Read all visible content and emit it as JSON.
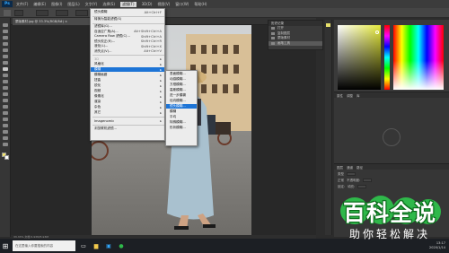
{
  "menubar": {
    "logo": "Ps",
    "items": [
      "文件(F)",
      "编辑(E)",
      "图像(I)",
      "图层(L)",
      "文字(Y)",
      "选择(S)",
      "滤镜(T)",
      "3D(D)",
      "视图(V)",
      "窗口(W)",
      "帮助(H)"
    ],
    "active_index": 6
  },
  "document_tab": "蒙版素材.jpg @ 33.3%(RGB/8#) ×",
  "filter_menu": {
    "items": [
      {
        "label": "镜头模糊",
        "shortcut": "Alt+Ctrl+F"
      },
      {
        "label": "转换为智能滤镜(S)",
        "shortcut": ""
      },
      {
        "label": "滤镜库(G)...",
        "shortcut": ""
      },
      {
        "label": "自适应广角(A)...",
        "shortcut": "Alt+Shift+Ctrl+A"
      },
      {
        "label": "Camera Raw 滤镜(C)...",
        "shortcut": "Shift+Ctrl+A"
      },
      {
        "label": "镜头校正(R)...",
        "shortcut": "Shift+Ctrl+R"
      },
      {
        "label": "液化(L)...",
        "shortcut": "Shift+Ctrl+X"
      },
      {
        "label": "消失点(V)...",
        "shortcut": "Alt+Ctrl+V"
      },
      {
        "label": "3D",
        "shortcut": "▸"
      },
      {
        "label": "风格化",
        "shortcut": "▸"
      },
      {
        "label": "模糊",
        "shortcut": "▸"
      },
      {
        "label": "模糊画廊",
        "shortcut": "▸"
      },
      {
        "label": "扭曲",
        "shortcut": "▸"
      },
      {
        "label": "锐化",
        "shortcut": "▸"
      },
      {
        "label": "视频",
        "shortcut": "▸"
      },
      {
        "label": "像素化",
        "shortcut": "▸"
      },
      {
        "label": "渲染",
        "shortcut": "▸"
      },
      {
        "label": "杂色",
        "shortcut": "▸"
      },
      {
        "label": "其它",
        "shortcut": "▸"
      },
      {
        "label": "Imagenomic",
        "shortcut": "▸"
      },
      {
        "label": "浏览联机滤镜...",
        "shortcut": ""
      }
    ]
  },
  "blur_submenu": {
    "items": [
      "表面模糊...",
      "动感模糊...",
      "方框模糊...",
      "高斯模糊...",
      "进一步模糊",
      "径向模糊...",
      "镜头模糊...",
      "模糊",
      "平均",
      "特殊模糊...",
      "形状模糊..."
    ],
    "highlight_index": 6
  },
  "history_panel": {
    "title": "历史记录",
    "items": [
      "打开",
      "复制图层",
      "蒙版素材",
      "画笔工具"
    ],
    "selected_index": 3
  },
  "props_panel": {
    "tabs": [
      "属性",
      "调整",
      "库"
    ]
  },
  "layers_panel": {
    "tabs": [
      "图层",
      "通道",
      "路径"
    ],
    "kind_label": "类型",
    "mode_label": "正常",
    "opacity_label": "不透明度:",
    "lock_label": "锁定:",
    "fill_label": "填充:"
  },
  "status": "33.33%    文档:5.93M/5.93M",
  "taskbar": {
    "search_placeholder": "在这里输入你要搜索的内容",
    "time": "13:17",
    "date": "2020/1/14"
  },
  "watermark": {
    "title": "百科全说",
    "subtitle": "助你轻松解决"
  },
  "colors": {
    "menu_highlight": "#1d74d6",
    "foreground": "#f2e36b",
    "background": "#ffffff"
  }
}
